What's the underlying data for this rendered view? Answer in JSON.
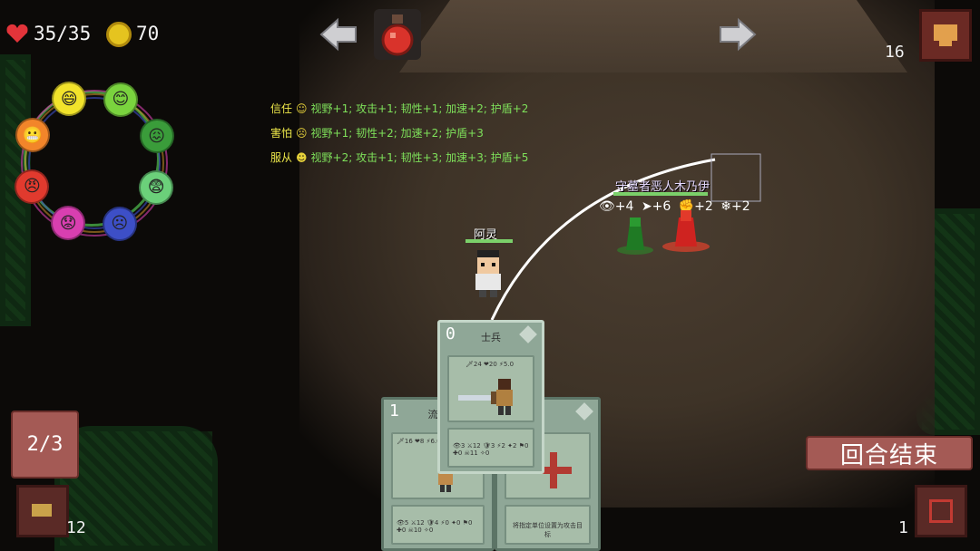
{
  "hud": {
    "hp": "35/35",
    "gold": "70",
    "turn_counter": "16",
    "heart_color": "#e3343a",
    "coin_color": "#e5c41f",
    "icons": {
      "heart": "heart-icon",
      "coin": "coin-icon",
      "prev": "arrow-left-icon",
      "next": "arrow-right-icon",
      "potion": "potion-icon",
      "menu": "monitor-icon"
    }
  },
  "emotions": [
    {
      "name": "happy",
      "color": "#f2e32b",
      "glyph": "😄"
    },
    {
      "name": "trust",
      "color": "#7ad33e",
      "glyph": "😊"
    },
    {
      "name": "sick",
      "color": "#3a9c3a",
      "glyph": "😖"
    },
    {
      "name": "scared",
      "color": "#6bd07a",
      "glyph": "😨"
    },
    {
      "name": "sad",
      "color": "#3d4fc7",
      "glyph": "☹"
    },
    {
      "name": "upset",
      "color": "#d83fb0",
      "glyph": "😟"
    },
    {
      "name": "angry",
      "color": "#e13a2e",
      "glyph": "😠"
    },
    {
      "name": "grimace",
      "color": "#f2852a",
      "glyph": "😬"
    }
  ],
  "log": [
    {
      "head": "信任",
      "body": "视野+1; 攻击+1; 韧性+1; 加速+2; 护盾+2"
    },
    {
      "head": "害怕",
      "body": "视野+1; 韧性+2; 加速+2; 护盾+3"
    },
    {
      "head": "服从",
      "body": "视野+2; 攻击+1; 韧性+3; 加速+3; 护盾+5"
    }
  ],
  "player": {
    "name": "阿灵"
  },
  "enemy": {
    "name": "守墓者恶人木乃伊",
    "stats": [
      {
        "icon": "eye-icon",
        "value": "+4"
      },
      {
        "icon": "speed-icon",
        "value": "+6"
      },
      {
        "icon": "strength-icon",
        "value": "+2"
      },
      {
        "icon": "shield-icon",
        "value": "+2"
      }
    ]
  },
  "cards": [
    {
      "cost": "0",
      "title": "士兵",
      "stats": "🗡24 ❤20 ⚡5.0",
      "sub": "👁3 ⚔12 🛡3 ⚡2 ✦2 ⚑0 ✚0 ☠11 ✧0"
    },
    {
      "cost": "1",
      "title": "流浪",
      "stats": "🗡16 ❤8 ⚡6.0",
      "sub": "👁5 ⚔12 🛡4 ⚡0 ✦0 ⚑0 ✚0 ☠10 ✧0"
    },
    {
      "cost": "",
      "title": "",
      "desc": "将指定单位设置为攻击目标"
    }
  ],
  "controls": {
    "end_turn": "回合结束",
    "energy": "2/3",
    "draw_pile": "12",
    "discard_pile": "1"
  }
}
